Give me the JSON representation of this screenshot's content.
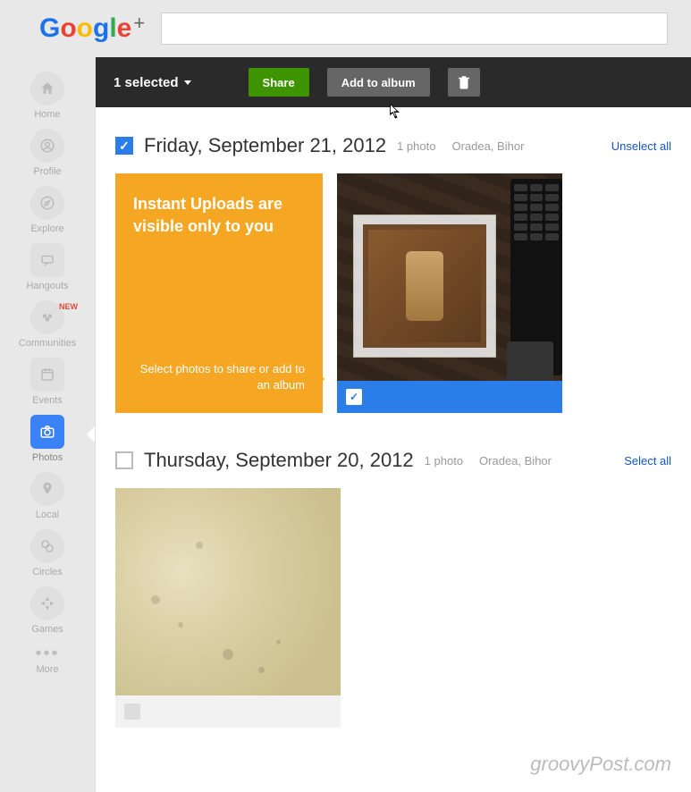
{
  "header": {
    "logo_text": "Google"
  },
  "nav": [
    {
      "label": "Home",
      "icon": "home-icon"
    },
    {
      "label": "Profile",
      "icon": "profile-icon"
    },
    {
      "label": "Explore",
      "icon": "compass-icon"
    },
    {
      "label": "Hangouts",
      "icon": "chat-icon"
    },
    {
      "label": "Communities",
      "icon": "people-icon",
      "badge": "NEW"
    },
    {
      "label": "Events",
      "icon": "calendar-icon"
    },
    {
      "label": "Photos",
      "icon": "camera-icon",
      "active": true
    },
    {
      "label": "Local",
      "icon": "pin-icon"
    },
    {
      "label": "Circles",
      "icon": "circles-icon"
    },
    {
      "label": "Games",
      "icon": "games-icon"
    },
    {
      "label": "More",
      "icon": "more-icon"
    }
  ],
  "selection_bar": {
    "count_label": "1 selected",
    "share_label": "Share",
    "add_album_label": "Add to album"
  },
  "info_card": {
    "headline": "Instant Uploads are visible only to you",
    "subtext": "Select photos to share or add to an album"
  },
  "sections": [
    {
      "checked": true,
      "title": "Friday, September 21, 2012",
      "photo_count": "1 photo",
      "location": "Oradea, Bihor",
      "select_link": "Unselect all",
      "photo_selected": true
    },
    {
      "checked": false,
      "title": "Thursday, September 20, 2012",
      "photo_count": "1 photo",
      "location": "Oradea, Bihor",
      "select_link": "Select all",
      "photo_selected": false
    }
  ],
  "watermark": "groovyPost.com"
}
